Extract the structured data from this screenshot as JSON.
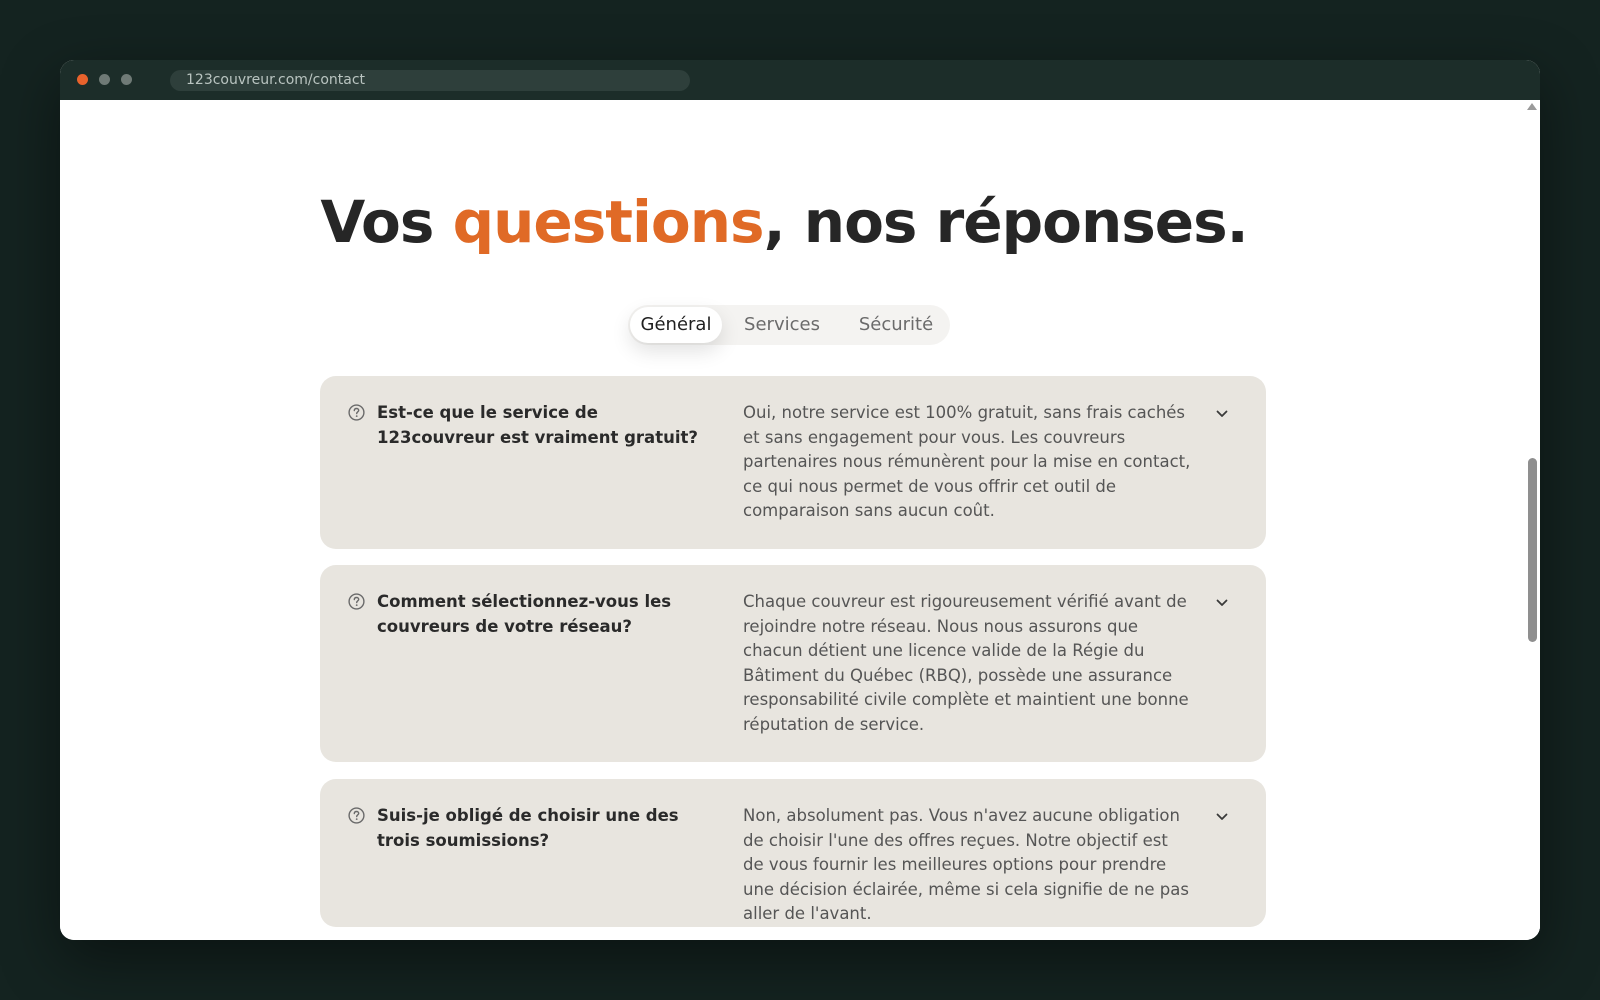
{
  "window": {
    "url": "123couvreur.com/contact",
    "dot_colors": [
      "#e8622c",
      "#6f7a76",
      "#6f7a76"
    ]
  },
  "heading": {
    "part1": "Vos ",
    "highlight": "questions",
    "part2": ", nos réponses.",
    "highlight_color": "#e06a26"
  },
  "tabs": [
    {
      "label": "Général",
      "active": true
    },
    {
      "label": "Services",
      "active": false
    },
    {
      "label": "Sécurité",
      "active": false
    }
  ],
  "faq": [
    {
      "question": "Est-ce que le service de 123couvreur est vraiment gratuit?",
      "answer": "Oui, notre service est 100% gratuit, sans frais cachés et sans engagement pour vous. Les couvreurs partenaires nous rémunèrent pour la mise en contact, ce qui nous permet de vous offrir cet outil de comparaison sans aucun coût.",
      "icon": "question-circle-icon"
    },
    {
      "question": "Comment sélectionnez-vous les couvreurs de votre réseau?",
      "answer": "Chaque couvreur est rigoureusement vérifié avant de rejoindre notre réseau. Nous nous assurons que chacun détient une licence valide de la Régie du Bâtiment du Québec (RBQ), possède une assurance responsabilité civile complète et maintient une bonne réputation de service.",
      "icon": "question-circle-icon"
    },
    {
      "question": "Suis-je obligé de choisir une des trois soumissions?",
      "answer": "Non, absolument pas. Vous n'avez aucune obligation de choisir l'une des offres reçues. Notre objectif est de vous fournir les meilleures options pour prendre une décision éclairée, même si cela signifie de ne pas aller de l'avant.",
      "icon": "question-circle-icon"
    }
  ]
}
